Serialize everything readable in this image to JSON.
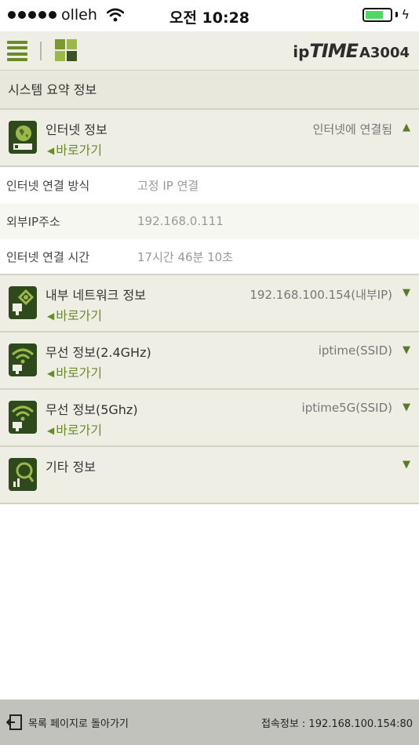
{
  "status_bar": {
    "carrier": "olleh",
    "time": "오전 10:28"
  },
  "header": {
    "logo_prefix": "ip",
    "logo_brand": "TIME",
    "model": "A3004"
  },
  "section_title": "시스템 요약 정보",
  "groups": [
    {
      "title": "인터넷 정보",
      "shortcut": "바로가기",
      "status": "인터넷에 연결됨",
      "expanded": true
    },
    {
      "title": "내부 네트워크 정보",
      "shortcut": "바로가기",
      "status": "192.168.100.154(내부IP)",
      "expanded": false
    },
    {
      "title": "무선 정보(2.4GHz)",
      "shortcut": "바로가기",
      "status": "iptime(SSID)",
      "expanded": false
    },
    {
      "title": "무선 정보(5Ghz)",
      "shortcut": "바로가기",
      "status": "iptime5G(SSID)",
      "expanded": false
    },
    {
      "title": "기타 정보",
      "shortcut": "",
      "status": "",
      "expanded": false
    }
  ],
  "internet_details": [
    {
      "label": "인터넷 연결 방식",
      "value": "고정 IP 연결"
    },
    {
      "label": "외부IP주소",
      "value": "192.168.0.111"
    },
    {
      "label": "인터넷 연결 시간",
      "value": "17시간 46분 10초"
    }
  ],
  "footer": {
    "back_label": "목록 페이지로 돌아가기",
    "connection_info": "접속정보 : 192.168.100.154:80"
  },
  "colors": {
    "accent_green": "#6b8b2a",
    "icon_dark_green": "#2e4a1c",
    "panel_bg": "#eeeee4",
    "battery_green": "#4cd964"
  }
}
